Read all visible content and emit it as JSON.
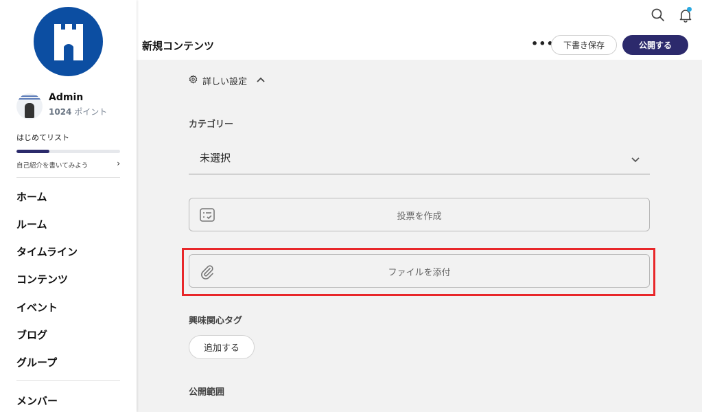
{
  "colors": {
    "brand": "#0c4ea2",
    "primary_button": "#2c2a6c",
    "highlight": "#e8272a",
    "notification": "#29a8e0"
  },
  "user": {
    "name": "Admin",
    "points_value": "1024",
    "points_unit": "ポイント"
  },
  "checklist": {
    "title": "はじめてリスト",
    "progress": 0.32,
    "next_step": "自己紹介を書いてみよう"
  },
  "nav": [
    "ホーム",
    "ルーム",
    "タイムライン",
    "コンテンツ",
    "イベント",
    "ブログ",
    "グループ",
    "メンバー"
  ],
  "header": {
    "title": "新規コンテンツ",
    "more_label": "•••",
    "draft_label": "下書き保存",
    "publish_label": "公開する"
  },
  "icons": {
    "search": "search-icon",
    "bell": "bell-icon",
    "gear": "gear-icon",
    "poll": "poll-icon",
    "paperclip": "paperclip-icon"
  },
  "settings": {
    "advanced_label": "詳しい設定",
    "category_label": "カテゴリー",
    "category_value": "未選択",
    "poll_button": "投票を作成",
    "attach_button": "ファイルを添付",
    "tags_label": "興味関心タグ",
    "add_tag_button": "追加する",
    "visibility_label": "公開範囲"
  }
}
